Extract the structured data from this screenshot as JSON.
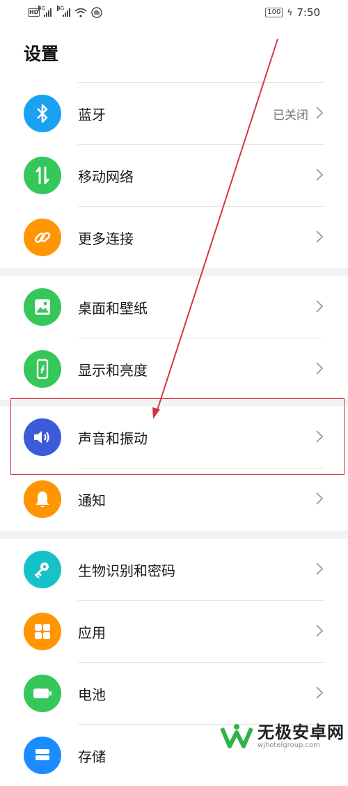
{
  "status_bar": {
    "hd_label": "HD",
    "net_1": "4G",
    "net_2": "4G",
    "battery": "100",
    "time": "7:50"
  },
  "page": {
    "title": "设置"
  },
  "items": [
    {
      "label": "蓝牙",
      "value": "已关闭",
      "icon": "bluetooth-icon",
      "color": "#1ba1f2"
    },
    {
      "label": "移动网络",
      "value": "",
      "icon": "mobile-network-icon",
      "color": "#35c759"
    },
    {
      "label": "更多连接",
      "value": "",
      "icon": "link-icon",
      "color": "#ff9500"
    },
    {
      "label": "桌面和壁纸",
      "value": "",
      "icon": "wallpaper-icon",
      "color": "#35c759"
    },
    {
      "label": "显示和亮度",
      "value": "",
      "icon": "display-icon",
      "color": "#35c759"
    },
    {
      "label": "声音和振动",
      "value": "",
      "icon": "sound-icon",
      "color": "#3b5bdb"
    },
    {
      "label": "通知",
      "value": "",
      "icon": "bell-icon",
      "color": "#ff9500"
    },
    {
      "label": "生物识别和密码",
      "value": "",
      "icon": "key-icon",
      "color": "#16c1c8"
    },
    {
      "label": "应用",
      "value": "",
      "icon": "apps-icon",
      "color": "#ff9500"
    },
    {
      "label": "电池",
      "value": "",
      "icon": "battery-icon",
      "color": "#35c759"
    },
    {
      "label": "存储",
      "value": "",
      "icon": "storage-icon",
      "color": "#1a8cff"
    }
  ],
  "annotation": {
    "highlight_color": "#d9333f"
  },
  "watermark": {
    "title": "无极安卓网",
    "url": "wjhotelgroup.com"
  }
}
